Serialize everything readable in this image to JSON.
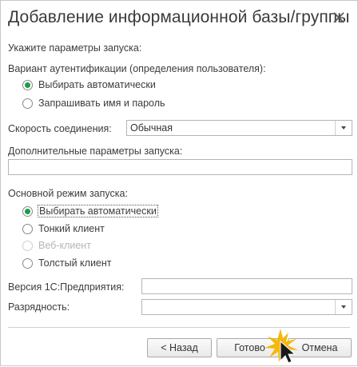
{
  "window": {
    "title": "Добавление информационной базы/группы"
  },
  "form": {
    "launch_params_heading": "Укажите параметры запуска:",
    "auth_heading": "Вариант аутентификации (определения пользователя):",
    "auth_options": [
      {
        "label": "Выбирать автоматически",
        "selected": true
      },
      {
        "label": "Запрашивать имя и пароль",
        "selected": false
      }
    ],
    "speed_label": "Скорость соединения:",
    "speed_value": "Обычная",
    "extra_params_label": "Дополнительные параметры запуска:",
    "extra_params_value": "",
    "mode_heading": "Основной режим запуска:",
    "mode_options": [
      {
        "label": "Выбирать автоматически",
        "selected": true,
        "disabled": false
      },
      {
        "label": "Тонкий клиент",
        "selected": false,
        "disabled": false
      },
      {
        "label": "Веб-клиент",
        "selected": false,
        "disabled": true
      },
      {
        "label": "Толстый клиент",
        "selected": false,
        "disabled": false
      }
    ],
    "version_label": "Версия 1С:Предприятия:",
    "version_value": "",
    "bitness_label": "Разрядность:",
    "bitness_value": ""
  },
  "buttons": {
    "back": "< Назад",
    "finish": "Готово",
    "cancel": "Отмена"
  },
  "colors": {
    "radio_selected": "#1f9a4c",
    "cursor_highlight": "#f5b400"
  }
}
